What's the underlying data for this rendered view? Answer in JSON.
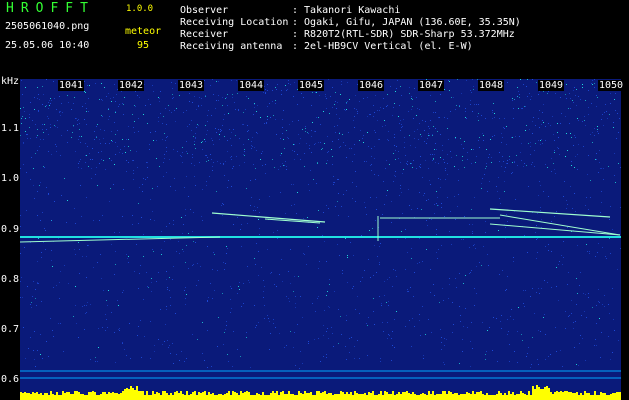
{
  "header": {
    "app_title": "HROFFT",
    "app_version": "1.0.0",
    "filename": "2505061040.png",
    "timestamp": "25.05.06 10:40",
    "mode_label": "meteor",
    "count_value": "95"
  },
  "station_info": [
    {
      "label": "Observer",
      "value": ": Takanori Kawachi"
    },
    {
      "label": "Receiving Location",
      "value": ": Ogaki, Gifu, JAPAN (136.60E, 35.35N)"
    },
    {
      "label": "Receiver",
      "value": ": R820T2(RTL-SDR) SDR-Sharp 53.372MHz"
    },
    {
      "label": "Receiving antenna",
      "value": ": 2el-HB9CV Vertical (el. E-W)"
    }
  ],
  "spectrogram": {
    "y_unit": "kHz",
    "y_ticks": [
      "1.1",
      "1.0",
      "0.9",
      "0.8",
      "0.7",
      "0.6"
    ],
    "time_labels": [
      "1041",
      "1042",
      "1043",
      "1044",
      "1045",
      "1046",
      "1047",
      "1048",
      "1049",
      "1050"
    ],
    "colors": {
      "background": "#0a1a7a",
      "noise_band": "#1e4ad8",
      "trace": "#20e0e0",
      "echo": "#9fffd0",
      "signal_bar": "#ffff00",
      "baseline": "#00a8ff"
    }
  }
}
